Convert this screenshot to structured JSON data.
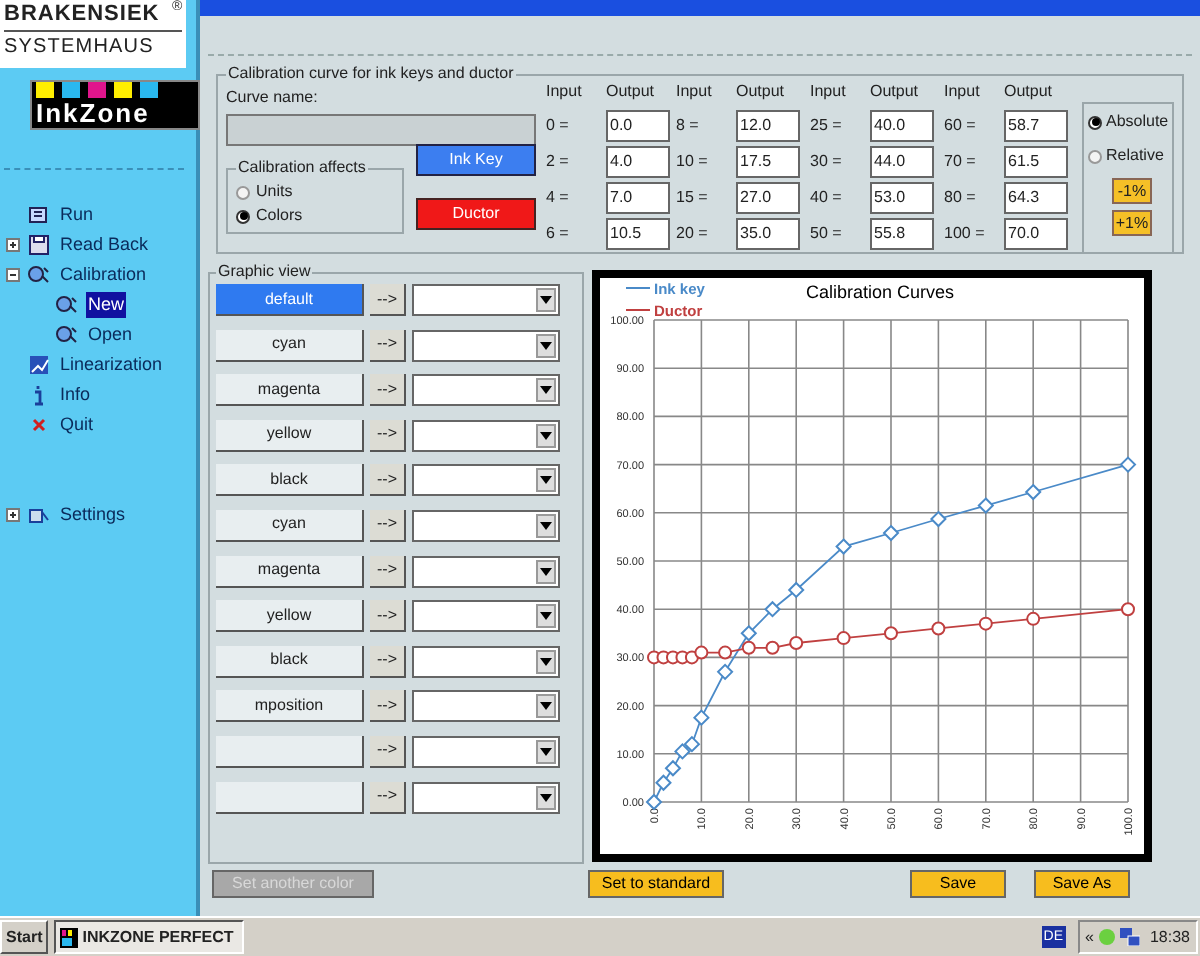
{
  "logo": {
    "line_1": "BRAKENSIEK",
    "line_2": "SYSTEMHAUS",
    "mark": "®"
  },
  "product_logo": {
    "text": "InkZone"
  },
  "nav": [
    {
      "label": "Run",
      "kind": "run",
      "selected": false
    },
    {
      "label": "Read Back",
      "kind": "disk",
      "selected": false,
      "expanded": false
    },
    {
      "label": "Calibration",
      "kind": "calib",
      "selected": false,
      "expanded": true,
      "children": [
        {
          "label": "New",
          "kind": "calib",
          "selected": true
        },
        {
          "label": "Open",
          "kind": "calib",
          "selected": false
        }
      ]
    },
    {
      "label": "Linearization",
      "kind": "chart",
      "selected": false
    },
    {
      "label": "Info",
      "kind": "info",
      "selected": false
    },
    {
      "label": "Quit",
      "kind": "quit",
      "selected": false
    }
  ],
  "nav_bottom": [
    {
      "label": "Settings",
      "kind": "settings",
      "selected": false,
      "expanded": false
    }
  ],
  "calibration": {
    "title": "Calibration curve for ink keys and ductor",
    "curve_name_label": "Curve name:",
    "affects": {
      "title": "Calibration affects",
      "options": [
        {
          "label": "Units",
          "selected": false
        },
        {
          "label": "Colors",
          "selected": true
        }
      ]
    },
    "ink_key_button": "Ink Key",
    "ductor_button": "Ductor",
    "columns": [
      {
        "input_header": "Input",
        "output_header": "Output",
        "rows": [
          [
            "0 =",
            "0.0"
          ],
          [
            "2 =",
            "4.0"
          ],
          [
            "4 =",
            "7.0"
          ],
          [
            "6 =",
            "10.5"
          ]
        ]
      },
      {
        "input_header": "Input",
        "output_header": "Output",
        "rows": [
          [
            "8 =",
            "12.0"
          ],
          [
            "10 =",
            "17.5"
          ],
          [
            "15 =",
            "27.0"
          ],
          [
            "20 =",
            "35.0"
          ]
        ]
      },
      {
        "input_header": "Input",
        "output_header": "Output",
        "rows": [
          [
            "25 =",
            "40.0"
          ],
          [
            "30 =",
            "44.0"
          ],
          [
            "40 =",
            "53.0"
          ],
          [
            "50 =",
            "55.8"
          ]
        ]
      },
      {
        "input_header": "Input",
        "output_header": "Output",
        "rows": [
          [
            "60 =",
            "58.7"
          ],
          [
            "70 =",
            "61.5"
          ],
          [
            "80 =",
            "64.3"
          ],
          [
            "100 =",
            "70.0"
          ]
        ]
      }
    ],
    "mode": [
      {
        "label": "Absolute",
        "selected": true
      },
      {
        "label": "Relative",
        "selected": false
      }
    ],
    "minus_button": "-1%",
    "plus_button": "+1%"
  },
  "graphic_view": {
    "title": "Graphic view",
    "arrow": "-->",
    "rows": [
      {
        "label": "default",
        "selected": true
      },
      {
        "label": "cyan",
        "selected": false
      },
      {
        "label": "magenta",
        "selected": false
      },
      {
        "label": "yellow",
        "selected": false
      },
      {
        "label": "black",
        "selected": false
      },
      {
        "label": "cyan",
        "selected": false
      },
      {
        "label": "magenta",
        "selected": false
      },
      {
        "label": "yellow",
        "selected": false
      },
      {
        "label": "black",
        "selected": false
      },
      {
        "label": "mposition",
        "selected": false
      },
      {
        "label": "",
        "selected": false
      },
      {
        "label": "",
        "selected": false
      }
    ]
  },
  "chart_data": {
    "type": "line",
    "title": "Calibration Curves",
    "grid": true,
    "x": [
      0,
      2,
      4,
      6,
      8,
      10,
      15,
      20,
      25,
      30,
      40,
      50,
      60,
      70,
      80,
      100
    ],
    "series": [
      {
        "name": "Ink key",
        "color": "#4a8ac8",
        "marker": "diamond",
        "values": [
          0,
          4,
          7,
          10.5,
          12,
          17.5,
          27,
          35,
          40,
          44,
          53,
          55.8,
          58.7,
          61.5,
          64.3,
          70
        ]
      },
      {
        "name": "Ductor",
        "color": "#c04040",
        "marker": "circle",
        "values": [
          30,
          30,
          30,
          30,
          30,
          31,
          31,
          32,
          32,
          33,
          34,
          35,
          36,
          37,
          38,
          40
        ]
      }
    ],
    "xlim": [
      0,
      100
    ],
    "ylim": [
      0,
      100
    ],
    "xticks": [
      {
        "value": 0,
        "label": "0.0"
      },
      {
        "value": 10,
        "label": "10.0"
      },
      {
        "value": 20,
        "label": "20.0"
      },
      {
        "value": 30,
        "label": "30.0"
      },
      {
        "value": 40,
        "label": "40.0"
      },
      {
        "value": 50,
        "label": "50.0"
      },
      {
        "value": 60,
        "label": "60.0"
      },
      {
        "value": 70,
        "label": "70.0"
      },
      {
        "value": 80,
        "label": "80.0"
      },
      {
        "value": 90,
        "label": "90.0"
      },
      {
        "value": 100,
        "label": "100.0"
      }
    ],
    "yticks": [
      {
        "value": 0,
        "label": "0.00"
      },
      {
        "value": 10,
        "label": "10.00"
      },
      {
        "value": 20,
        "label": "20.00"
      },
      {
        "value": 30,
        "label": "30.00"
      },
      {
        "value": 40,
        "label": "40.00"
      },
      {
        "value": 50,
        "label": "50.00"
      },
      {
        "value": 60,
        "label": "60.00"
      },
      {
        "value": 70,
        "label": "70.00"
      },
      {
        "value": 80,
        "label": "80.00"
      },
      {
        "value": 90,
        "label": "90.00"
      },
      {
        "value": 100,
        "label": "100.00"
      }
    ]
  },
  "bottom_buttons": [
    {
      "label": "Set another color",
      "disabled": true
    },
    {
      "label": "Set to standard",
      "disabled": false
    },
    {
      "label": "Save",
      "disabled": false
    },
    {
      "label": "Save As",
      "disabled": false
    }
  ],
  "taskbar": {
    "start": "Start",
    "task": "INKZONE PERFECT",
    "language": "DE",
    "chevron": "«",
    "clock": "18:38"
  }
}
